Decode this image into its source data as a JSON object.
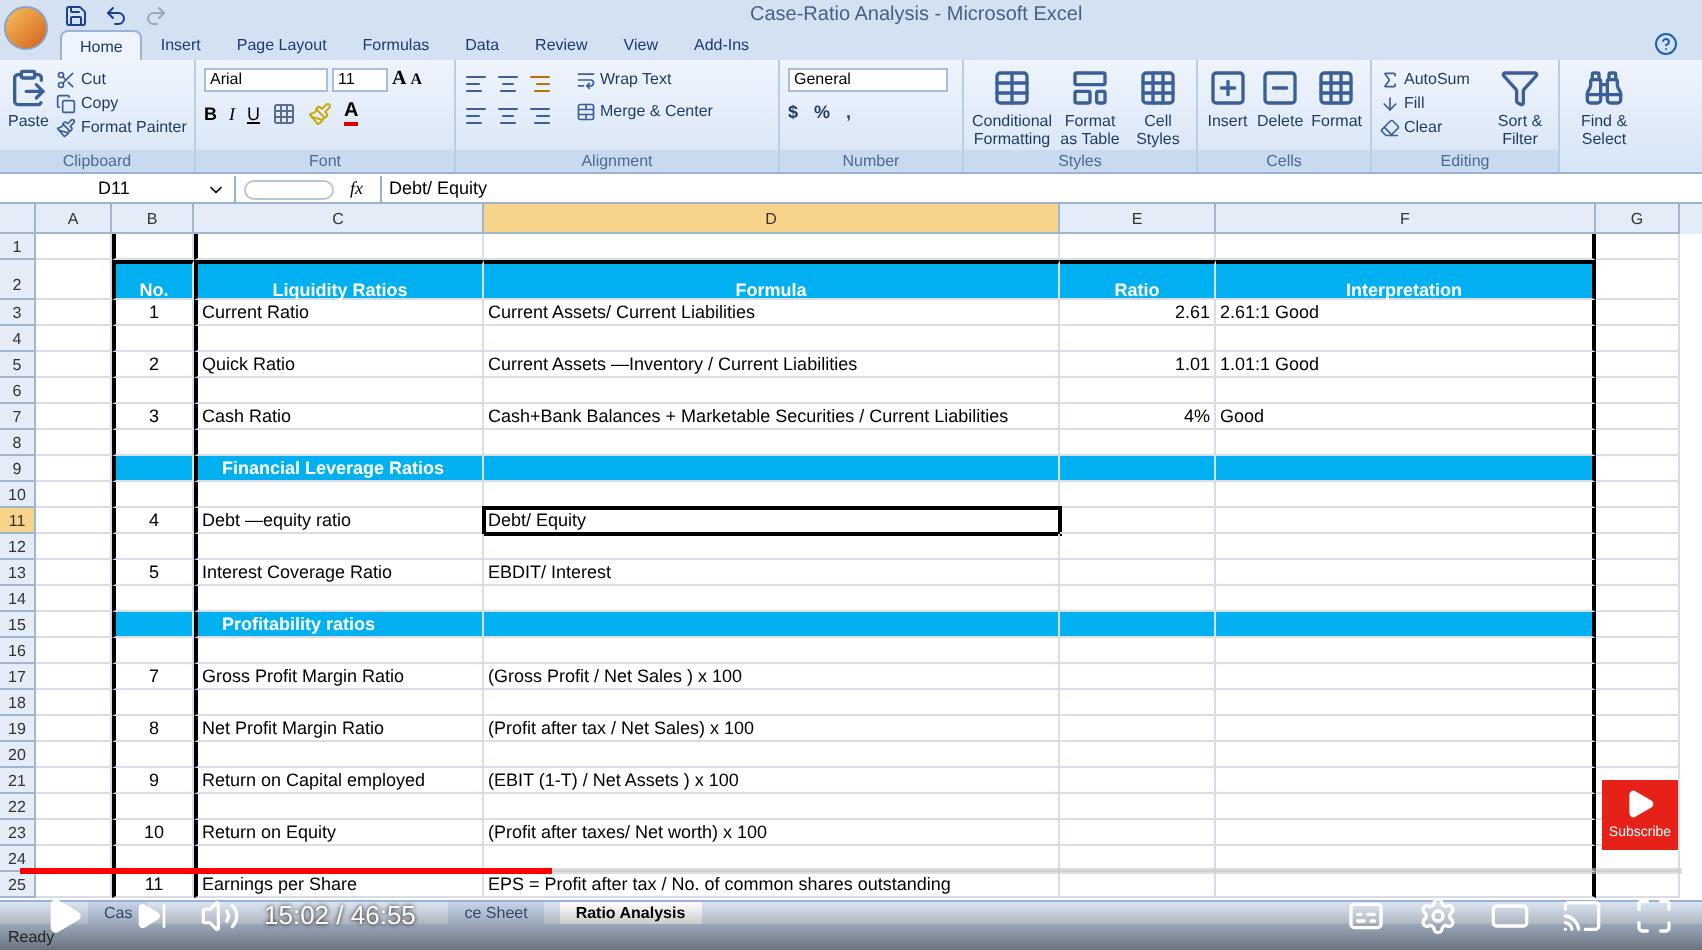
{
  "window": {
    "title": "Case-Ratio Analysis - Microsoft Excel"
  },
  "ribbon_tabs": [
    {
      "label": "Home",
      "selected": true
    },
    {
      "label": "Insert",
      "selected": false
    },
    {
      "label": "Page Layout",
      "selected": false
    },
    {
      "label": "Formulas",
      "selected": false
    },
    {
      "label": "Data",
      "selected": false
    },
    {
      "label": "Review",
      "selected": false
    },
    {
      "label": "View",
      "selected": false
    },
    {
      "label": "Add-Ins",
      "selected": false
    }
  ],
  "clipboard": {
    "paste": "Paste",
    "cut": "Cut",
    "copy": "Copy",
    "format_painter": "Format Painter",
    "label": "Clipboard"
  },
  "font": {
    "name": "Arial",
    "size": "11",
    "grow": "A",
    "shrink": "A",
    "bold": "B",
    "italic": "I",
    "underline": "U",
    "font_color_button": "A",
    "label": "Font"
  },
  "alignment": {
    "wrap": "Wrap Text",
    "merge": "Merge & Center",
    "label": "Alignment"
  },
  "number": {
    "format": "General",
    "currency": "$",
    "percent": "%",
    "comma": ",",
    "label": "Number"
  },
  "styles": {
    "items": [
      "Conditional Formatting",
      "Format as Table",
      "Cell Styles"
    ],
    "label": "Styles"
  },
  "cells": {
    "items": [
      "Insert",
      "Delete",
      "Format"
    ],
    "label": "Cells"
  },
  "editing": {
    "autosum": "AutoSum",
    "fill": "Fill",
    "clear": "Clear",
    "sort": "Sort & Filter",
    "find": "Find & Select",
    "label": "Editing"
  },
  "formula_bar": {
    "name_box": "D11",
    "fx": "fx",
    "value": "Debt/ Equity"
  },
  "columns": [
    {
      "label": "A",
      "selected": false
    },
    {
      "label": "B",
      "selected": false
    },
    {
      "label": "C",
      "selected": false
    },
    {
      "label": "D",
      "selected": true
    },
    {
      "label": "E",
      "selected": false
    },
    {
      "label": "F",
      "selected": false
    },
    {
      "label": "G",
      "selected": false
    }
  ],
  "rows": [
    {
      "number": "1",
      "selected": false,
      "kind": "blank"
    },
    {
      "number": "2",
      "selected": false,
      "kind": "header",
      "no": "No.",
      "ratio_name": "Liquidity Ratios",
      "formula": "Formula",
      "ratio": "Ratio",
      "interpretation": "Interpretation"
    },
    {
      "number": "3",
      "selected": false,
      "kind": "data",
      "no": "1",
      "ratio_name": "Current Ratio",
      "formula": "Current Assets/ Current Liabilities",
      "ratio": "2.61",
      "interpretation": "2.61:1  Good"
    },
    {
      "number": "4",
      "selected": false,
      "kind": "blank"
    },
    {
      "number": "5",
      "selected": false,
      "kind": "data",
      "no": "2",
      "ratio_name": "Quick Ratio",
      "formula": "Current Assets —Inventory / Current Liabilities",
      "ratio": "1.01",
      "interpretation": "1.01:1  Good"
    },
    {
      "number": "6",
      "selected": false,
      "kind": "blank"
    },
    {
      "number": "7",
      "selected": false,
      "kind": "data",
      "no": "3",
      "ratio_name": "Cash Ratio",
      "formula": "Cash+Bank Balances + Marketable Securities / Current Liabilities",
      "ratio": "4%",
      "interpretation": "Good"
    },
    {
      "number": "8",
      "selected": false,
      "kind": "blank"
    },
    {
      "number": "9",
      "selected": false,
      "kind": "section",
      "label": "Financial Leverage Ratios"
    },
    {
      "number": "10",
      "selected": false,
      "kind": "blank"
    },
    {
      "number": "11",
      "selected": true,
      "kind": "data",
      "no": "4",
      "ratio_name": "Debt —equity ratio",
      "formula": "Debt/ Equity",
      "formula_selected": true
    },
    {
      "number": "12",
      "selected": false,
      "kind": "blank"
    },
    {
      "number": "13",
      "selected": false,
      "kind": "data",
      "no": "5",
      "ratio_name": "Interest Coverage Ratio",
      "formula": "EBDIT/ Interest"
    },
    {
      "number": "14",
      "selected": false,
      "kind": "blank"
    },
    {
      "number": "15",
      "selected": false,
      "kind": "section",
      "label": "Profitability ratios"
    },
    {
      "number": "16",
      "selected": false,
      "kind": "blank"
    },
    {
      "number": "17",
      "selected": false,
      "kind": "data",
      "no": "7",
      "ratio_name": "Gross Profit Margin Ratio",
      "formula": "(Gross Profit / Net Sales ) x 100"
    },
    {
      "number": "18",
      "selected": false,
      "kind": "blank"
    },
    {
      "number": "19",
      "selected": false,
      "kind": "data",
      "no": "8",
      "ratio_name": "Net Profit Margin Ratio",
      "formula": "(Profit after tax / Net Sales) x 100"
    },
    {
      "number": "20",
      "selected": false,
      "kind": "blank"
    },
    {
      "number": "21",
      "selected": false,
      "kind": "data",
      "no": "9",
      "ratio_name": "Return on Capital employed",
      "formula": "(EBIT (1-T) / Net Assets ) x 100"
    },
    {
      "number": "22",
      "selected": false,
      "kind": "blank"
    },
    {
      "number": "23",
      "selected": false,
      "kind": "data",
      "no": "10",
      "ratio_name": "Return on Equity",
      "formula": "(Profit after taxes/ Net worth) x 100"
    },
    {
      "number": "24",
      "selected": false,
      "kind": "blank"
    },
    {
      "number": "25",
      "selected": false,
      "kind": "data",
      "no": "11",
      "ratio_name": "Earnings per Share",
      "formula": "EPS = Profit after tax / No. of common shares outstanding"
    }
  ],
  "sheet_tabs": [
    {
      "label": "Cas",
      "selected": false
    },
    {
      "label": "ce Sheet",
      "selected": false
    },
    {
      "label": "Ratio Analysis",
      "selected": true
    }
  ],
  "status_bar": {
    "text": "Ready"
  },
  "player": {
    "level": 0.32,
    "time": "15:02 / 46:55",
    "subscribe": "Subscribe"
  }
}
